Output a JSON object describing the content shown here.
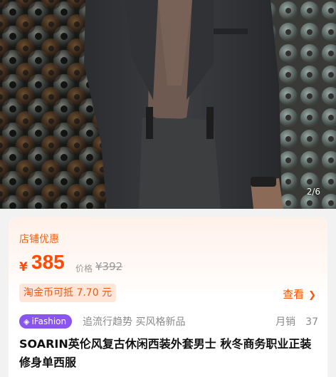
{
  "gallery": {
    "indicator": "2/6",
    "image_subject": "model-wearing-grey-tweed-suit-jacket"
  },
  "promo": {
    "shop_discount_label": "店铺优惠",
    "currency": "¥",
    "price": "385",
    "original_price_label": "价格",
    "original_price": "¥392",
    "coin_offer": "淘金币可抵 7.70 元",
    "view_label": "查看",
    "view_icon": "chevron-right-icon"
  },
  "meta": {
    "badge": "iFashion",
    "badge_icon": "ifashion-logo-icon",
    "tagline": "追流行趋势 买风格新品",
    "sales_label": "月销",
    "sales_count": "37"
  },
  "product": {
    "title": "SOARIN英伦风复古休闲西装外套男士 秋冬商务职业正装修身单西服"
  },
  "colors": {
    "accent": "#ff4a00",
    "promo_text": "#f0651e",
    "badge": "#8a55ee"
  }
}
